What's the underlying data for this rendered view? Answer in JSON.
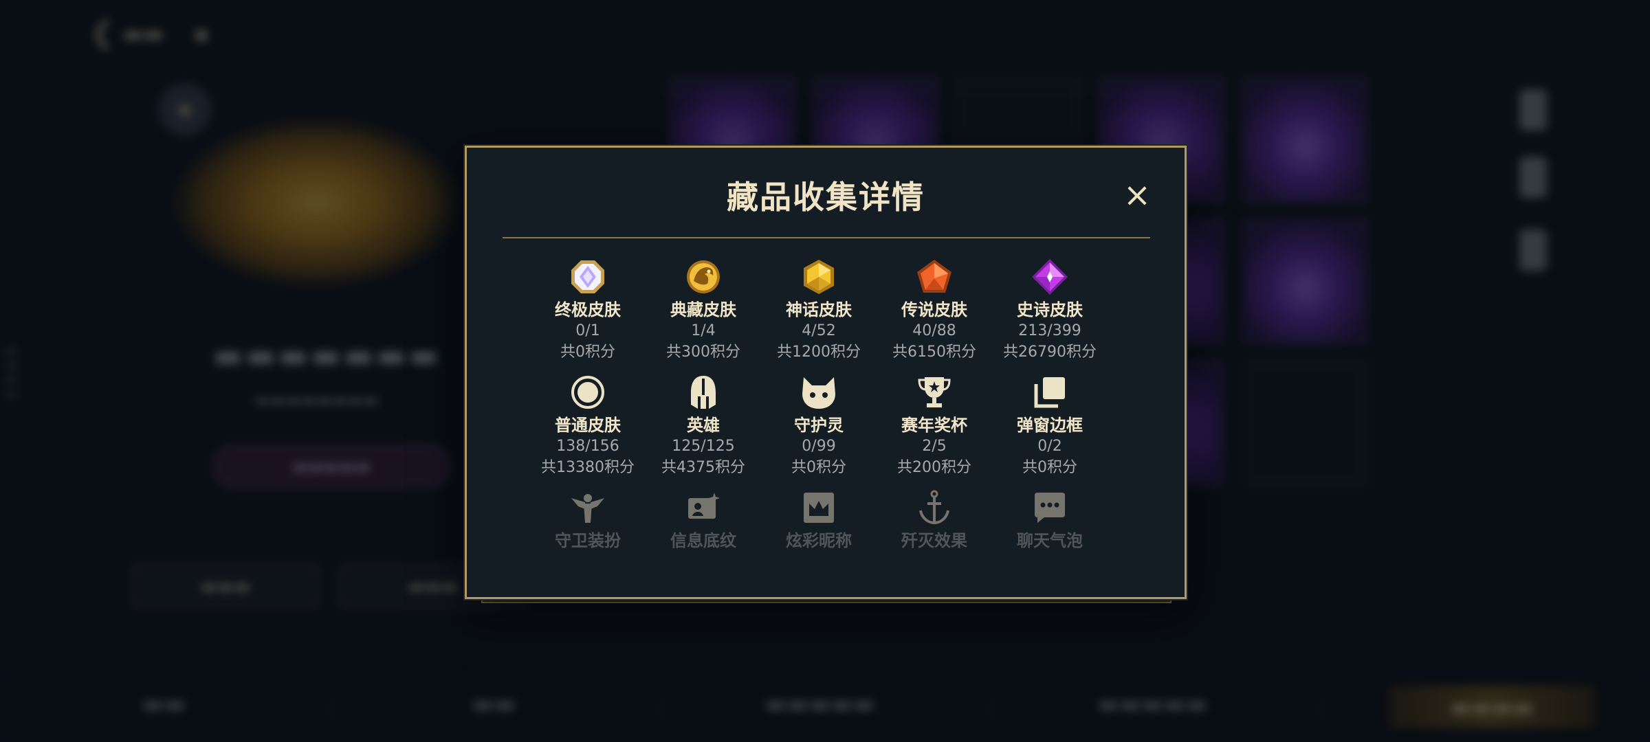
{
  "modal": {
    "title": "藏品收集详情",
    "close_label": "×",
    "rows": [
      [
        {
          "icon": "octagon-gem-icon",
          "label": "终极皮肤",
          "count": "0/1",
          "points": "共0积分"
        },
        {
          "icon": "dragon-gem-icon",
          "label": "典藏皮肤",
          "count": "1/4",
          "points": "共300积分"
        },
        {
          "icon": "hexagon-gem-icon",
          "label": "神话皮肤",
          "count": "4/52",
          "points": "共1200积分"
        },
        {
          "icon": "pentagon-gem-icon",
          "label": "传说皮肤",
          "count": "40/88",
          "points": "共6150积分"
        },
        {
          "icon": "diamond-gem-icon",
          "label": "史诗皮肤",
          "count": "213/399",
          "points": "共26790积分"
        }
      ],
      [
        {
          "icon": "circle-ring-icon",
          "label": "普通皮肤",
          "count": "138/156",
          "points": "共13380积分"
        },
        {
          "icon": "helmet-icon",
          "label": "英雄",
          "count": "125/125",
          "points": "共4375积分"
        },
        {
          "icon": "cat-face-icon",
          "label": "守护灵",
          "count": "0/99",
          "points": "共0积分"
        },
        {
          "icon": "trophy-icon",
          "label": "赛年奖杯",
          "count": "2/5",
          "points": "共200积分"
        },
        {
          "icon": "stacked-frames-icon",
          "label": "弹窗边框",
          "count": "0/2",
          "points": "共0积分"
        }
      ],
      [
        {
          "icon": "winged-figure-icon",
          "label": "守卫装扮"
        },
        {
          "icon": "card-sparkle-icon",
          "label": "信息底纹"
        },
        {
          "icon": "crown-frame-icon",
          "label": "炫彩昵称"
        },
        {
          "icon": "anchor-icon",
          "label": "歼灭效果"
        },
        {
          "icon": "chat-bubble-icon",
          "label": "聊天气泡"
        }
      ]
    ]
  },
  "colors": {
    "modal_bg": "#141c24",
    "modal_border": "#b49a5e",
    "title": "#f0e4c4",
    "muted_text": "#a8a9ab",
    "gold_icon": "#e3b64a"
  }
}
